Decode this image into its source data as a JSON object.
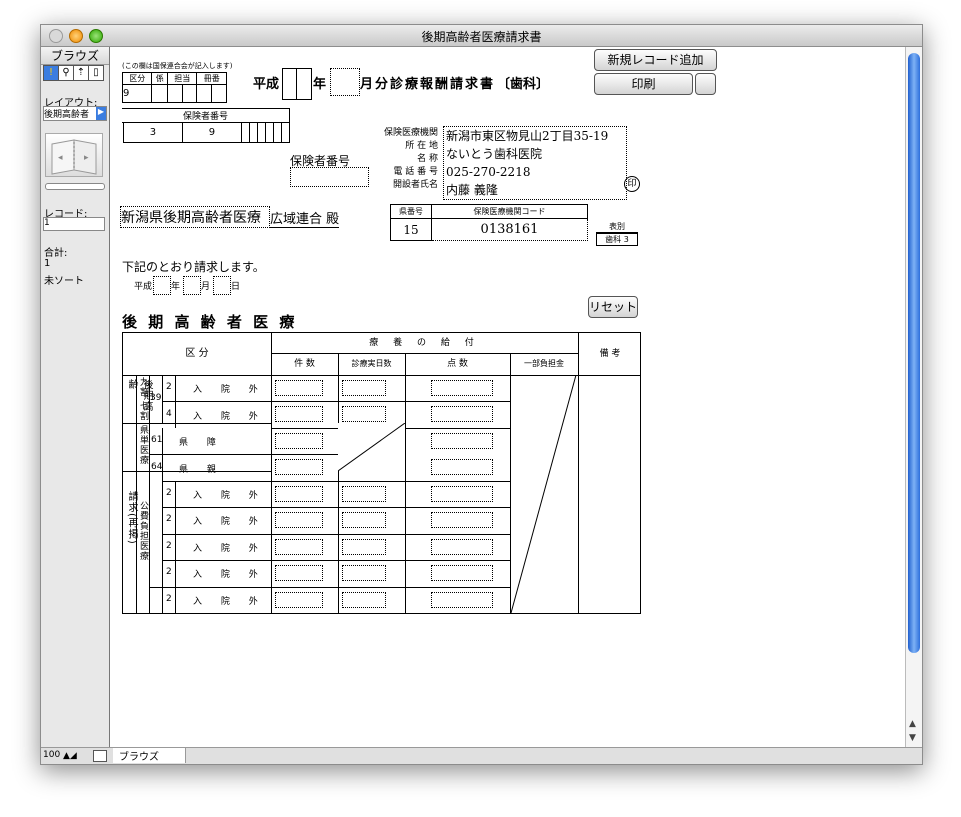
{
  "window": {
    "title": "後期高齢者医療請求書"
  },
  "sidebar": {
    "mode_title": "ブラウズ",
    "layout_label": "レイアウト:",
    "layout_value": "後期高齢者",
    "record_label": "レコード:",
    "record_value": "1",
    "total_label": "合計:",
    "total_value": "1",
    "sort_status": "未ソート"
  },
  "bottombar": {
    "zoom": "100",
    "mode": "ブラウズ"
  },
  "buttons": {
    "new_record": "新規レコード追加",
    "print": "印刷",
    "reset": "リセット"
  },
  "form": {
    "note": "(この欄は国保連合会が記入します)",
    "head_cols": [
      "区分",
      "係",
      "担当",
      "冊番"
    ],
    "head_val": "9",
    "insurer_no_label": "保険者番号",
    "insurer_digits": [
      "3",
      "9",
      "",
      "",
      "",
      "",
      "",
      ""
    ],
    "heading_prefix": "平成",
    "heading_year": "年",
    "heading_rest": "月分診療報酬請求書",
    "heading_dept": "〔歯科〕",
    "insurer_number_field_label": "保険者番号",
    "inst_labels": [
      "保険医療機関",
      "所 在 地",
      "名 称",
      "電 話 番 号",
      "開設者氏名"
    ],
    "inst_address": "新潟市東区物見山2丁目35-19",
    "inst_name": "ないとう歯科医院",
    "inst_phone": "025-270-2218",
    "inst_owner": "内藤 義隆",
    "seal": "印",
    "addressee": "新潟県後期高齢者医療",
    "addressee_suffix": "広域連合 殿",
    "pref_code_label": "県番号",
    "inst_code_label": "保険医療機関コード",
    "pref_code": "15",
    "inst_code": "0138161",
    "table_type_label": "表別",
    "table_type_value": "歯科 3",
    "request_text": "下記のとおり請求します。",
    "date_prefix": "平成",
    "date_year": "年",
    "date_month": "月",
    "date_day": "日",
    "section_title": "後 期 高 齢 者 医 療",
    "table": {
      "kubun": "区 分",
      "benefit": "療 養 の 給 付",
      "cols": [
        "件 数",
        "診療実日数",
        "点 数",
        "一部負担金"
      ],
      "biko": "備 考",
      "group1": "後期高齢",
      "rate9": "九割",
      "rate7": "七割",
      "code39": "39",
      "group2": "県単医療",
      "group3": "請求(再掲)",
      "group3sub": "公費負担医療",
      "rows": [
        {
          "n": "2",
          "code": "",
          "label": "入 院 外"
        },
        {
          "n": "4",
          "code": "",
          "label": "入 院 外"
        },
        {
          "n": "",
          "code": "61",
          "label": "県 障"
        },
        {
          "n": "",
          "code": "64",
          "label": "県 親"
        },
        {
          "n": "2",
          "code": "",
          "label": "入 院 外"
        },
        {
          "n": "2",
          "code": "",
          "label": "入 院 外"
        },
        {
          "n": "2",
          "code": "",
          "label": "入 院 外"
        },
        {
          "n": "2",
          "code": "",
          "label": "入 院 外"
        },
        {
          "n": "2",
          "code": "",
          "label": "入 院 外"
        }
      ]
    }
  },
  "colors": {
    "scroll_thumb": "#3b7de0",
    "window_bg": "#ffffff",
    "sidebar_bg": "#e8e8e8"
  }
}
